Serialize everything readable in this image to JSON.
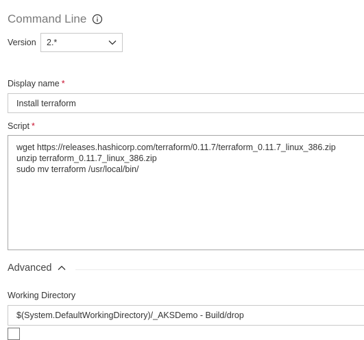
{
  "header": {
    "title": "Command Line",
    "info_icon": "info-icon"
  },
  "version": {
    "label": "Version",
    "selected": "2.*",
    "chevron_icon": "chevron-down-icon"
  },
  "display_name": {
    "label": "Display name",
    "required_marker": "*",
    "value": "Install terraform"
  },
  "script": {
    "label": "Script",
    "required_marker": "*",
    "lines": [
      "wget https://releases.hashicorp.com/terraform/0.11.7/terraform_0.11.7_linux_386.zip",
      "unzip terraform_0.11.7_linux_386.zip",
      "sudo mv terraform /usr/local/bin/"
    ]
  },
  "advanced": {
    "label": "Advanced",
    "chevron_icon": "chevron-up-icon",
    "expanded": true
  },
  "working_directory": {
    "label": "Working Directory",
    "value": "$(System.DefaultWorkingDirectory)/_AKSDemo - Build/drop"
  },
  "colors": {
    "required": "#c8102e",
    "title": "#7a7a7a",
    "border": "#c8c8c8"
  }
}
